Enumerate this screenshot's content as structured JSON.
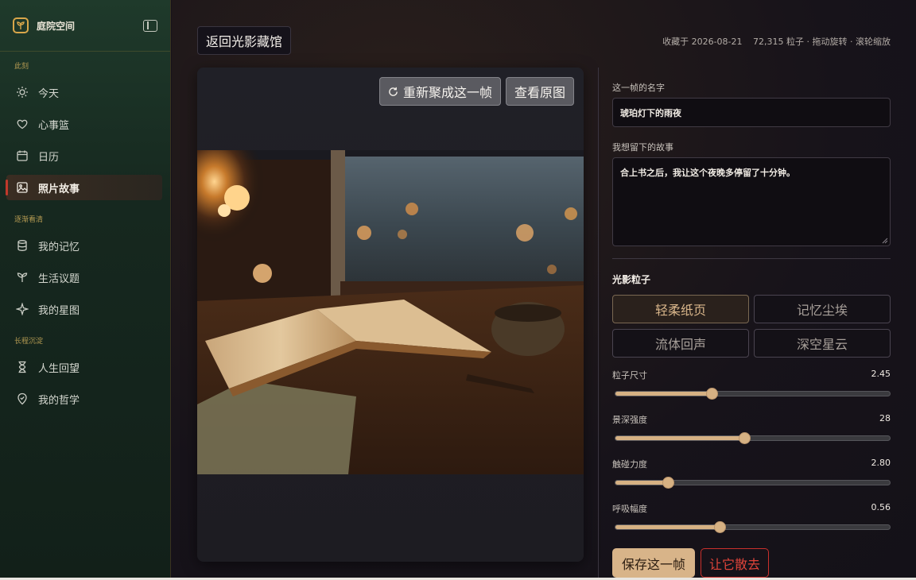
{
  "sidebar": {
    "brand": "庭院空间",
    "sections": [
      {
        "label": "此刻"
      },
      {
        "label": "逐渐看清"
      },
      {
        "label": "长程沉淀"
      }
    ],
    "items": [
      {
        "label": "今天",
        "icon": "sun-icon"
      },
      {
        "label": "心事篮",
        "icon": "heart-icon"
      },
      {
        "label": "日历",
        "icon": "calendar-icon"
      },
      {
        "label": "照片故事",
        "icon": "image-icon",
        "active": true
      },
      {
        "label": "我的记忆",
        "icon": "database-icon"
      },
      {
        "label": "生活议题",
        "icon": "sprout-icon"
      },
      {
        "label": "我的星图",
        "icon": "sparkle-icon"
      },
      {
        "label": "人生回望",
        "icon": "hourglass-icon"
      },
      {
        "label": "我的哲学",
        "icon": "badge-check-icon"
      }
    ]
  },
  "header": {
    "back_label": "返回光影藏馆",
    "saved": "收藏于 2026-08-21",
    "info": "72,315 粒子 · 拖动旋转 · 滚轮缩放"
  },
  "stage": {
    "reform_label": "重新聚成这一帧",
    "original_label": "查看原图"
  },
  "form": {
    "name_label": "这一帧的名字",
    "name_value": "琥珀灯下的雨夜",
    "story_label": "我想留下的故事",
    "story_value": "合上书之后，我让这个夜晚多停留了十分钟。"
  },
  "particles": {
    "title": "光影粒子",
    "modes": [
      "轻柔纸页",
      "记忆尘埃",
      "流体回声",
      "深空星云"
    ],
    "selected_mode": "轻柔纸页",
    "sliders": [
      {
        "label": "粒子尺寸",
        "value": "2.45",
        "fraction": 0.35
      },
      {
        "label": "景深强度",
        "value": "28",
        "fraction": 0.47
      },
      {
        "label": "触碰力度",
        "value": "2.80",
        "fraction": 0.19
      },
      {
        "label": "呼吸幅度",
        "value": "0.56",
        "fraction": 0.38
      }
    ]
  },
  "actions": {
    "save_label": "保存这一帧",
    "dismiss_label": "让它散去"
  },
  "colors": {
    "accent": "#d6b183",
    "danger": "#c9302c",
    "sidebar_top": "#1f3a2b",
    "section_label": "#b49a52"
  }
}
